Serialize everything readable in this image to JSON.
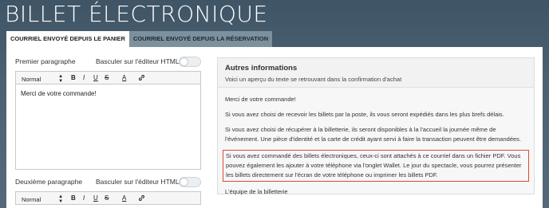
{
  "page": {
    "title": "BILLET ÉLECTRONIQUE"
  },
  "tabs": [
    {
      "label": "COURRIEL ENVOYÉ DEPUIS LE PANIER",
      "active": true
    },
    {
      "label": "COURRIEL ENVOYÉ DEPUIS LA RÉSERVATION",
      "active": false
    }
  ],
  "editors": [
    {
      "label": "Premier paragraphe",
      "toggle_label": "Basculer sur l'éditeur HTML",
      "format_select": "Normal",
      "content": "Merci de votre commande!"
    },
    {
      "label": "Deuxième paragraphe",
      "toggle_label": "Basculer sur l'éditeur HTML",
      "format_select": "Normal",
      "content": ""
    }
  ],
  "toolbar": {
    "bold": "B",
    "italic": "I",
    "underline": "U",
    "strike": "S",
    "color": "A"
  },
  "preview": {
    "title": "Autres informations",
    "subtitle": "Voici un aperçu du texte se retrouvant dans la confirmation d'achat",
    "paragraphs": [
      "Merci de votre commande!",
      "Si vous avez choisi de recevoir les billets par la poste, ils vous seront expédiés dans les plus brefs délais.",
      "Si vous avez choisi de récupérer à la billetterie, ils seront disponibles à la l'accueil la journée même de l'événement. Une pièce d'identité et la carte de crédit ayant servi à faire la transaction peuvent être demandées.",
      "Si vous avez commandé des billets électroniques, ceux-ci sont attachés à ce courriel dans un fichier PDF. Vous pouvez également les ajouter à votre téléphone via l'onglet Wallet. Le jour du spectacle, vous pourrez présenter les billets directement sur l'écran de votre téléphone ou imprimer les billets PDF.",
      "L'équipe de la billetterie"
    ],
    "highlight_color": "#d84a3a"
  }
}
